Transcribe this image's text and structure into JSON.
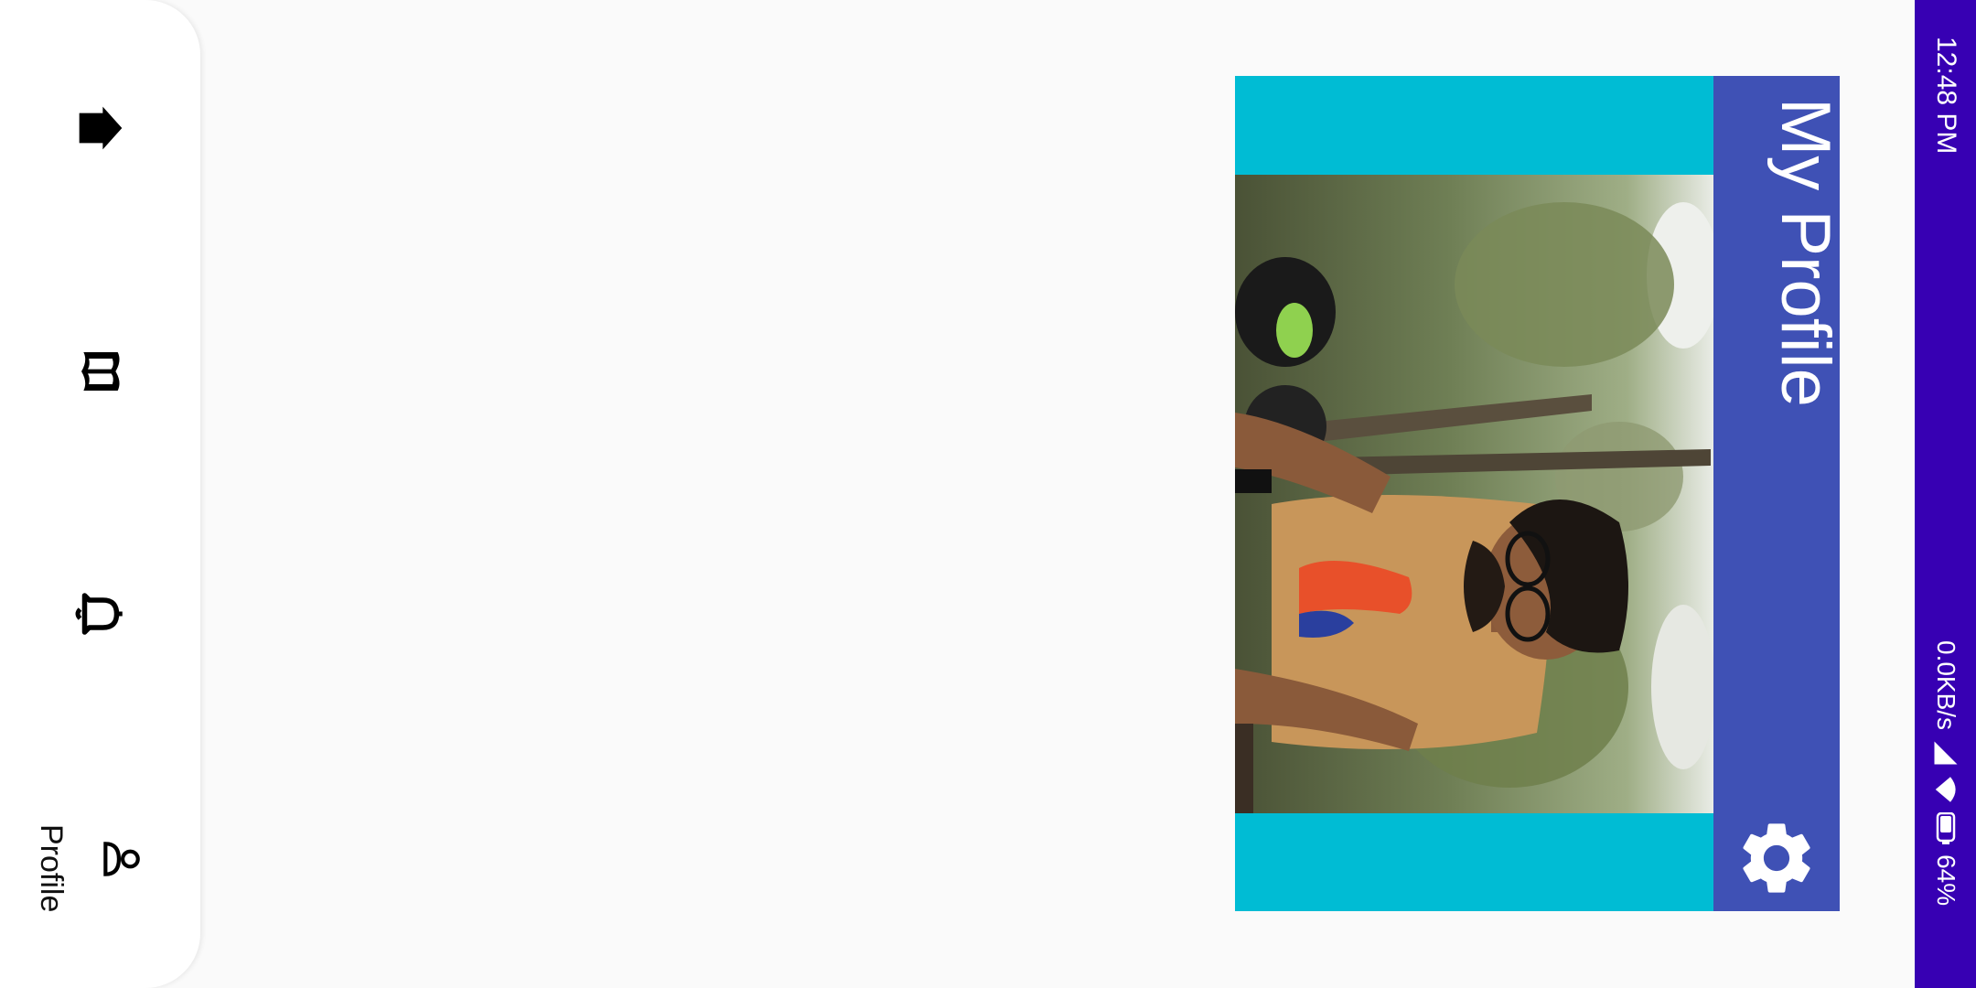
{
  "app": {
    "title": "My Profile"
  },
  "nav": {
    "items": [
      {
        "icon": "home-icon"
      },
      {
        "icon": "book-icon"
      },
      {
        "icon": "bell-icon"
      },
      {
        "icon": "profile-icon",
        "label": "Profile"
      }
    ]
  },
  "status": {
    "time": "12:48 PM",
    "speed": "0.0KB/s",
    "battery": "64%"
  },
  "colors": {
    "header": "#3f51b5",
    "accent": "#00bcd4",
    "status_bar": "#3700b3"
  }
}
